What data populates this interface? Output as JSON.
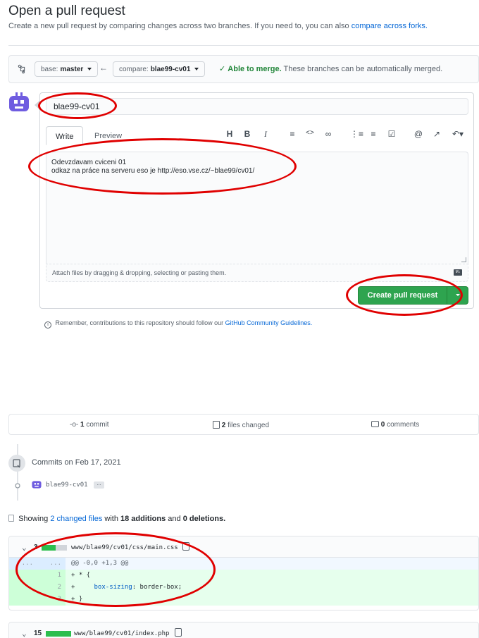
{
  "page": {
    "title": "Open a pull request",
    "subtitle": "Create a new pull request by comparing changes across two branches. If you need to, you can also",
    "subtitle_link": "compare across forks."
  },
  "range": {
    "base_label": "base:",
    "base_value": "master",
    "compare_label": "compare:",
    "compare_value": "blae99-cv01",
    "merge_status": "Able to merge.",
    "merge_detail": "These branches can be automatically merged."
  },
  "form": {
    "title_value": "blae99-cv01",
    "tabs": [
      "Write",
      "Preview"
    ],
    "body_lines": [
      "Odevzdavam cviceni 01",
      "odkaz na práce na serveru eso je http://eso.vse.cz/~blae99/cv01/"
    ],
    "attach_hint": "Attach files by dragging & dropping, selecting or pasting them.",
    "submit_label": "Create pull request",
    "toolbar_icons": [
      "heading-icon",
      "bold-icon",
      "italic-icon",
      "quote-icon",
      "code-icon",
      "link-icon",
      "bullet-list-icon",
      "numbered-list-icon",
      "task-list-icon",
      "mention-icon",
      "reference-icon",
      "reply-icon"
    ]
  },
  "guidelines": {
    "text": "Remember, contributions to this repository should follow our",
    "link": "GitHub Community Guidelines."
  },
  "stats": {
    "commits_count": "1",
    "commits_label": "commit",
    "files_count": "2",
    "files_label": "files changed",
    "comments_count": "0",
    "comments_label": "comments"
  },
  "commits": {
    "heading": "Commits on Feb 17, 2021",
    "items": [
      {
        "message": "blae99-cv01",
        "ellipsis": "..."
      }
    ]
  },
  "diff_summary": {
    "prefix": "Showing",
    "files_link": "2 changed files",
    "with": "with",
    "additions": "18 additions",
    "and": "and",
    "deletions": "0 deletions."
  },
  "files": [
    {
      "count": "3",
      "path": "www/blae99/cv01/css/main.css",
      "hunk_old": "...",
      "hunk_new": "...",
      "hunk_text": "@@ -0,0 +1,3 @@",
      "lines": [
        {
          "num": "1",
          "text": "+ * {"
        },
        {
          "num": "2",
          "prop": "box-sizing",
          "val": ": border-box;",
          "prefix": "+     "
        },
        {
          "num": "3",
          "text": "+ }"
        }
      ]
    },
    {
      "count": "15",
      "path": "www/blae99/cv01/index.php"
    }
  ],
  "colors": {
    "green": "#2ea44f",
    "link": "#0366d6",
    "annotation_red": "#e00000"
  }
}
